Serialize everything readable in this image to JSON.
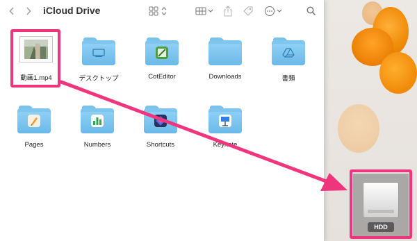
{
  "window": {
    "title": "iCloud Drive"
  },
  "toolbar": {
    "back_icon": "chevron-left-icon",
    "forward_icon": "chevron-right-icon",
    "view_icon": "grid-view-icon",
    "group_icon": "group-grid-icon",
    "share_icon": "share-icon",
    "tag_icon": "tag-icon",
    "more_icon": "ellipsis-circle-icon",
    "search_icon": "search-icon"
  },
  "items": [
    {
      "label": "動画1.mp4",
      "kind": "video"
    },
    {
      "label": "デスクトップ",
      "kind": "folder-desktop"
    },
    {
      "label": "CotEditor",
      "kind": "folder-app"
    },
    {
      "label": "Downloads",
      "kind": "folder"
    },
    {
      "label": "書類",
      "kind": "folder-drive"
    },
    {
      "label": "Pages",
      "kind": "folder-app"
    },
    {
      "label": "Numbers",
      "kind": "folder-app"
    },
    {
      "label": "Shortcuts",
      "kind": "folder-app"
    },
    {
      "label": "Keynote",
      "kind": "folder-app"
    }
  ],
  "desktop": {
    "drive_label": "HDD"
  },
  "colors": {
    "highlight": "#f0357f",
    "folder": "#7fc6ee",
    "arrow": "#f0357f"
  }
}
